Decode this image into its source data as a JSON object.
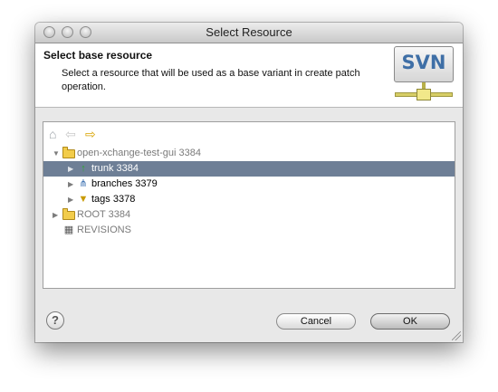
{
  "window": {
    "title": "Select Resource"
  },
  "header": {
    "title": "Select base resource",
    "description": "Select a resource that will be used as a base variant in create patch operation.",
    "logo_text": "SVN"
  },
  "toolbar": {
    "home_icon": "home-icon",
    "back_icon": "back-arrow-icon",
    "forward_icon": "forward-arrow-icon"
  },
  "tree": {
    "root": {
      "label": "open-xchange-test-gui 3384",
      "expanded": true
    },
    "children": [
      {
        "label": "trunk 3384",
        "icon": "trunk-icon",
        "selected": true
      },
      {
        "label": "branches 3379",
        "icon": "branches-icon",
        "selected": false
      },
      {
        "label": "tags 3378",
        "icon": "tags-icon",
        "selected": false
      }
    ],
    "root2": {
      "label": "ROOT 3384"
    },
    "revisions": {
      "label": "REVISIONS"
    }
  },
  "buttons": {
    "cancel": "Cancel",
    "ok": "OK",
    "help": "?"
  },
  "colors": {
    "selection": "#6e7f96",
    "forward_arrow": "#d8a400",
    "svn_text": "#3f6fa6"
  }
}
